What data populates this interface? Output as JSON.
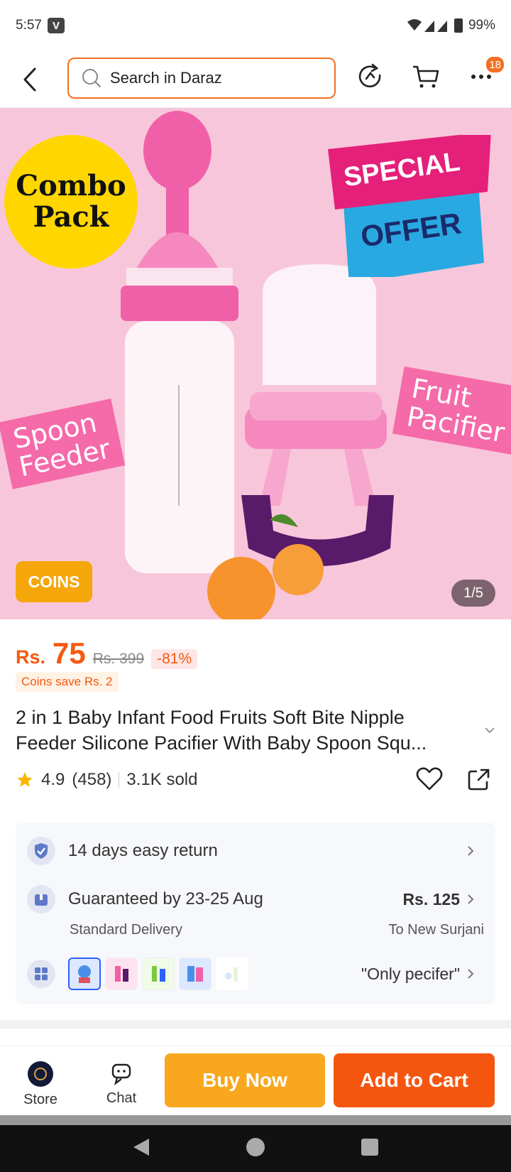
{
  "status_bar": {
    "time": "5:57",
    "app_badge": "V",
    "battery": "99%"
  },
  "header": {
    "search_placeholder": "Search in Daraz",
    "notification_count": "18"
  },
  "hero": {
    "combo_line1": "Combo",
    "combo_line2": "Pack",
    "special_line1": "SPECIAL",
    "special_line2": "OFFER",
    "label_left": "Spoon\nFeeder",
    "label_right": "Fruit\nPacifier",
    "coins_badge": "COINS",
    "image_counter": "1/5"
  },
  "product": {
    "currency": "Rs.",
    "price": "75",
    "original_price": "Rs. 399",
    "discount": "-81%",
    "coins_save": "Coins save Rs. 2",
    "title": "2 in 1 Baby Infant Food Fruits Soft Bite Nipple Feeder Silicone Pacifier With Baby Spoon Squ...",
    "rating": "4.9",
    "reviews": "(458)",
    "sold": "3.1K sold"
  },
  "info": {
    "return_label": "14 days easy return",
    "delivery_label": "Guaranteed by 23-25 Aug",
    "delivery_sub": "Standard Delivery",
    "delivery_price": "Rs. 125",
    "delivery_location": "To New Surjani",
    "variant_selected": "\"Only pecifer\""
  },
  "bottom_bar": {
    "store_label": "Store",
    "chat_label": "Chat",
    "buy_now_label": "Buy Now",
    "add_to_cart_label": "Add to Cart"
  },
  "colors": {
    "accent": "#f5590f",
    "buy_now": "#f8a71f",
    "add_to_cart": "#f5560f",
    "hero_bg": "#f8c6da"
  }
}
